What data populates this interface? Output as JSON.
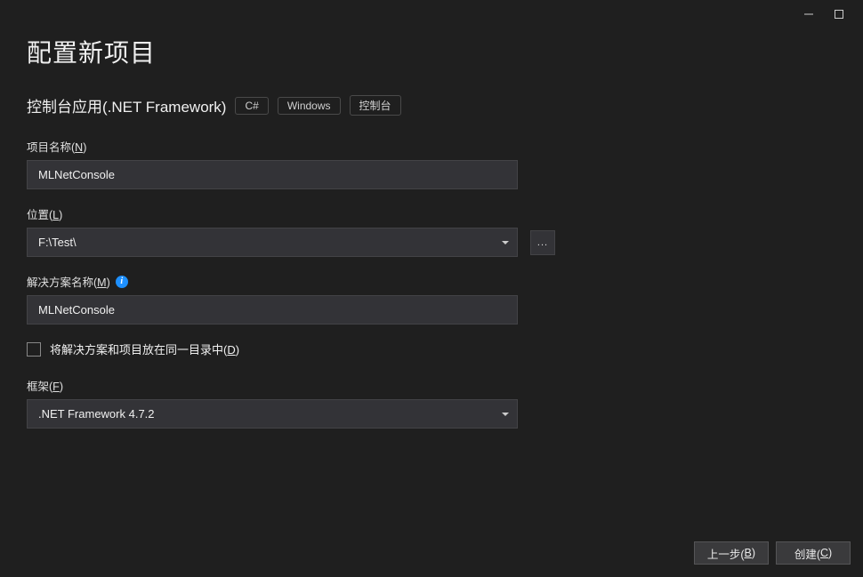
{
  "window": {
    "title": "配置新项目",
    "subtitle": "控制台应用(.NET Framework)",
    "tags": [
      "C#",
      "Windows",
      "控制台"
    ]
  },
  "fields": {
    "projectName": {
      "label_pre": "项目名称(",
      "label_key": "N",
      "label_post": ")",
      "value": "MLNetConsole"
    },
    "location": {
      "label_pre": "位置(",
      "label_key": "L",
      "label_post": ")",
      "value": "F:\\Test\\",
      "browse": "..."
    },
    "solutionName": {
      "label_pre": "解决方案名称(",
      "label_key": "M",
      "label_post": ")",
      "value": "MLNetConsole",
      "info_tooltip": "i"
    },
    "sameDir": {
      "label_pre": "将解决方案和项目放在同一目录中(",
      "label_key": "D",
      "label_post": ")",
      "checked": false
    },
    "framework": {
      "label_pre": "框架(",
      "label_key": "F",
      "label_post": ")",
      "value": ".NET Framework 4.7.2"
    }
  },
  "footer": {
    "back_pre": "上一步(",
    "back_key": "B",
    "back_post": ")",
    "create_pre": "创建(",
    "create_key": "C",
    "create_post": ")"
  }
}
